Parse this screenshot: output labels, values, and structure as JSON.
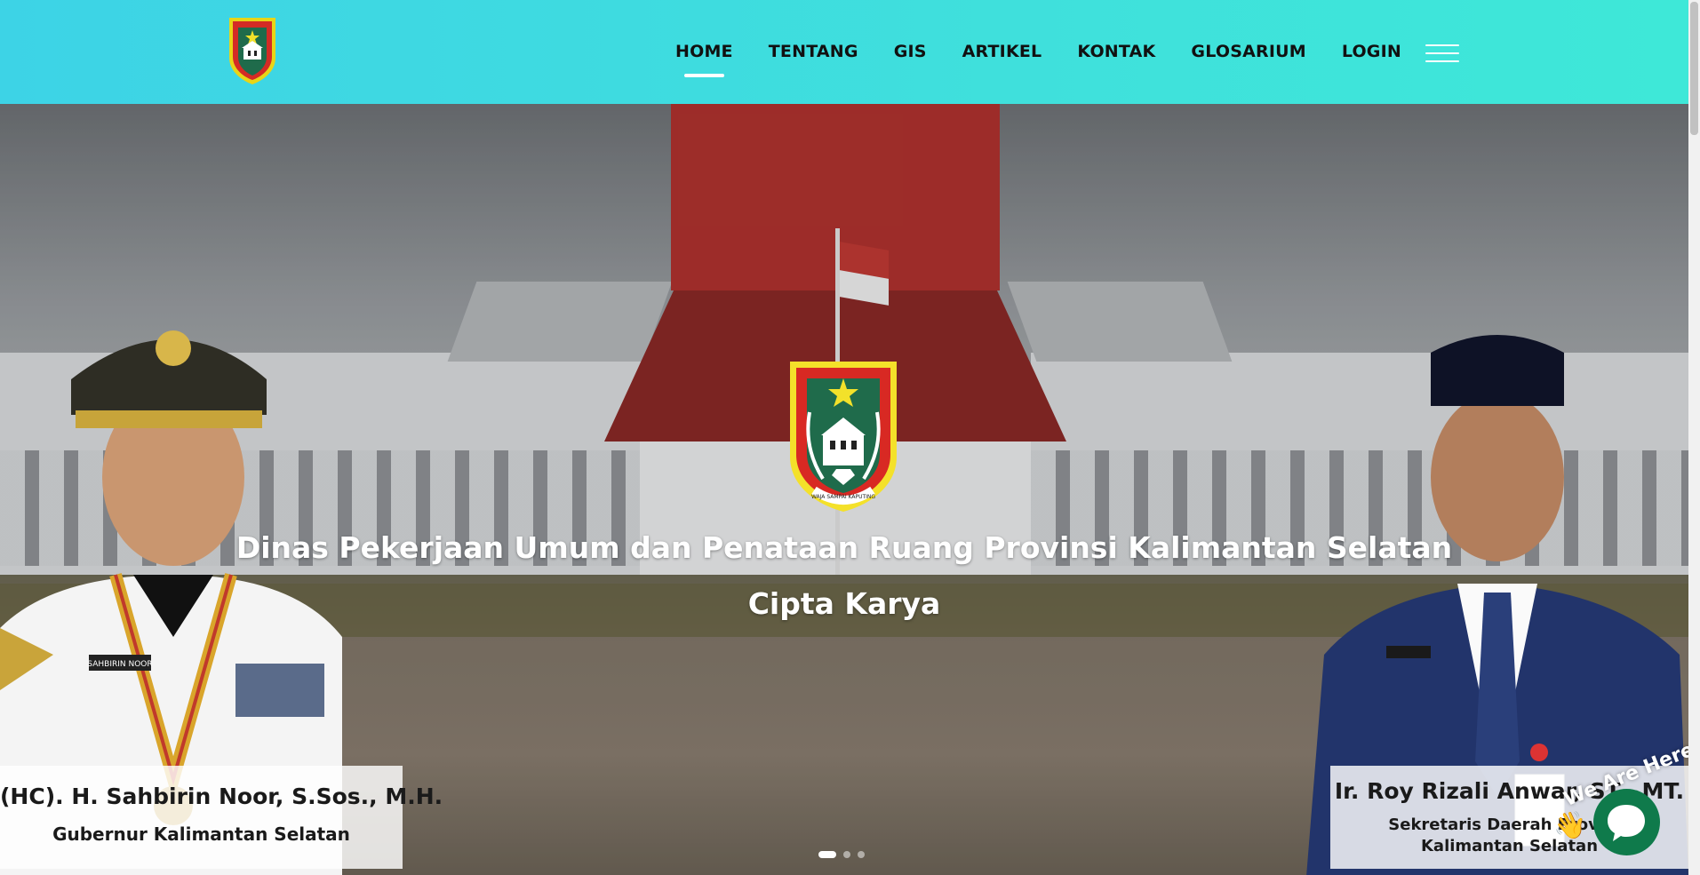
{
  "header": {
    "nav": [
      {
        "label": "HOME",
        "active": true
      },
      {
        "label": "TENTANG",
        "active": false
      },
      {
        "label": "GIS",
        "active": false
      },
      {
        "label": "ARTIKEL",
        "active": false
      },
      {
        "label": "KONTAK",
        "active": false
      },
      {
        "label": "GLOSARIUM",
        "active": false
      },
      {
        "label": "LOGIN",
        "active": false
      }
    ],
    "menu_icon": "hamburger-icon",
    "colors": {
      "bar_start": "#3dd3e6",
      "bar_end": "#3ee8d8",
      "active_underline": "#ffffff"
    }
  },
  "hero": {
    "title": "Dinas Pekerjaan Umum dan Penataan Ruang Provinsi Kalimantan Selatan",
    "subtitle": "Cipta Karya",
    "emblem_motto": "WAJA SAMPAI KAPUTING",
    "left_person": {
      "name": "(HC). H. Sahbirin Noor, S.Sos., M.H.",
      "title": "Gubernur Kalimantan Selatan",
      "name_tag": "SAHBIRIN NOOR"
    },
    "right_person": {
      "name": "Ir. Roy Rizali Anwar, ST., MT.",
      "title_line1": "Sekretaris Daerah Provinsi",
      "title_line2": "Kalimantan Selatan"
    },
    "slides": {
      "count": 3,
      "active": 1
    }
  },
  "chat": {
    "tag": "We Are Here!",
    "wave": "👋",
    "icon": "chat-bubble-icon",
    "color": "#0f7a4b"
  }
}
